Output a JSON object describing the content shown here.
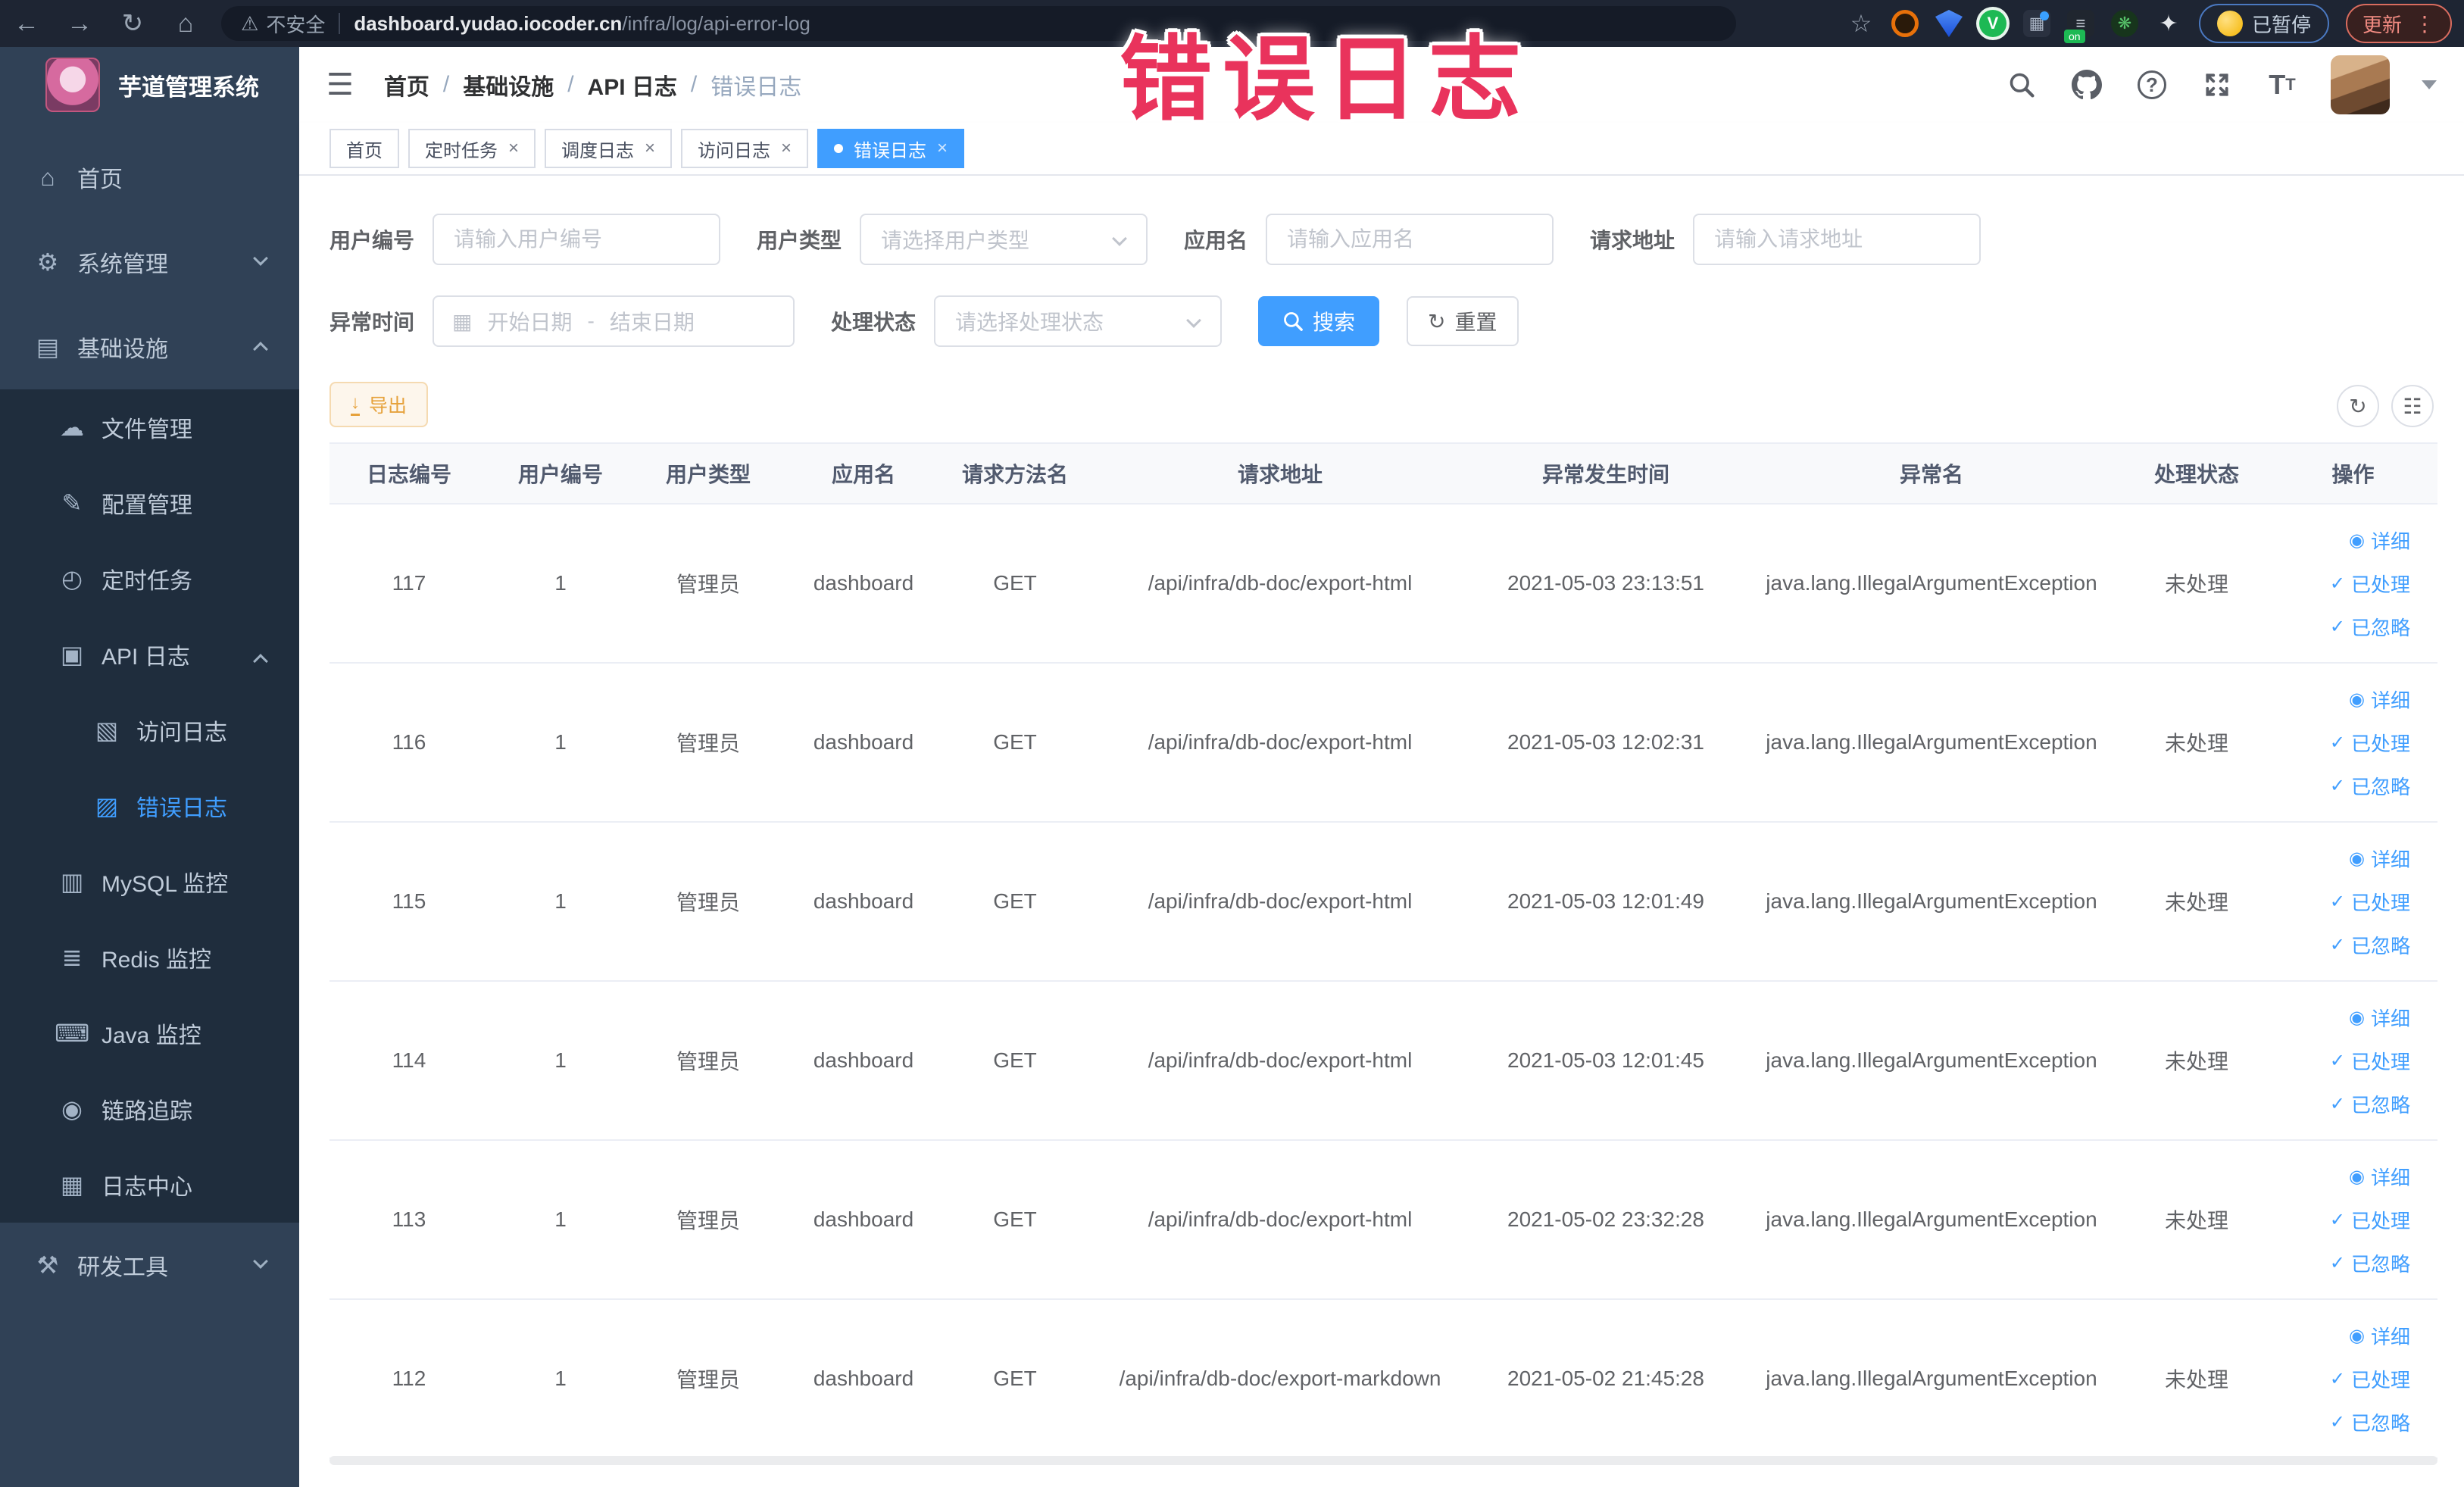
{
  "watermark": "错误日志",
  "browser": {
    "security_label": "不安全",
    "url_host": "dashboard.yudao.iocoder.cn",
    "url_path": "/infra/log/api-error-log",
    "paused_label": "已暂停",
    "update_label": "更新"
  },
  "sidebar": {
    "app_title": "芋道管理系统",
    "menu": [
      {
        "label": "首页",
        "icon": "home-icon",
        "glyph": "⌂"
      },
      {
        "label": "系统管理",
        "icon": "gear-icon",
        "glyph": "⚙",
        "chevron": "down"
      },
      {
        "label": "基础设施",
        "icon": "infrastructure-icon",
        "glyph": "▤",
        "chevron": "up",
        "children": [
          {
            "label": "文件管理",
            "icon": "file-upload-icon",
            "glyph": "☁"
          },
          {
            "label": "配置管理",
            "icon": "config-edit-icon",
            "glyph": "✎"
          },
          {
            "label": "定时任务",
            "icon": "scheduled-job-icon",
            "glyph": "◴"
          },
          {
            "label": "API 日志",
            "icon": "api-log-icon",
            "glyph": "▣",
            "chevron": "up",
            "children": [
              {
                "label": "访问日志",
                "icon": "access-log-icon",
                "glyph": "▧"
              },
              {
                "label": "错误日志",
                "icon": "error-log-icon",
                "glyph": "▨",
                "active": true
              }
            ]
          },
          {
            "label": "MySQL 监控",
            "icon": "mysql-monitor-icon",
            "glyph": "▥"
          },
          {
            "label": "Redis 监控",
            "icon": "redis-monitor-icon",
            "glyph": "≣"
          },
          {
            "label": "Java 监控",
            "icon": "java-monitor-icon",
            "glyph": "⌨"
          },
          {
            "label": "链路追踪",
            "icon": "trace-icon",
            "glyph": "◉"
          },
          {
            "label": "日志中心",
            "icon": "log-center-icon",
            "glyph": "▦"
          }
        ]
      },
      {
        "label": "研发工具",
        "icon": "dev-tool-icon",
        "glyph": "⚒",
        "chevron": "down"
      }
    ]
  },
  "navbar": {
    "breadcrumb": [
      "首页",
      "基础设施",
      "API 日志",
      "错误日志"
    ]
  },
  "tags": [
    {
      "label": "首页",
      "closable": false,
      "active": false
    },
    {
      "label": "定时任务",
      "closable": true,
      "active": false
    },
    {
      "label": "调度日志",
      "closable": true,
      "active": false
    },
    {
      "label": "访问日志",
      "closable": true,
      "active": false
    },
    {
      "label": "错误日志",
      "closable": true,
      "active": true
    }
  ],
  "filters": {
    "user_id_label": "用户编号",
    "user_id_placeholder": "请输入用户编号",
    "user_type_label": "用户类型",
    "user_type_placeholder": "请选择用户类型",
    "app_name_label": "应用名",
    "app_name_placeholder": "请输入应用名",
    "request_url_label": "请求地址",
    "request_url_placeholder": "请输入请求地址",
    "time_label": "异常时间",
    "time_start_placeholder": "开始日期",
    "time_separator": "-",
    "time_end_placeholder": "结束日期",
    "status_label": "处理状态",
    "status_placeholder": "请选择处理状态",
    "search_label": "搜索",
    "reset_label": "重置"
  },
  "toolbar": {
    "export_label": "导出"
  },
  "table": {
    "columns": [
      "日志编号",
      "用户编号",
      "用户类型",
      "应用名",
      "请求方法名",
      "请求地址",
      "异常发生时间",
      "异常名",
      "处理状态",
      "操作"
    ],
    "rows": [
      {
        "id": "117",
        "user_id": "1",
        "user_type": "管理员",
        "app_name": "dashboard",
        "method": "GET",
        "url": "/api/infra/db-doc/export-html",
        "time": "2021-05-03 23:13:51",
        "exception": "java.lang.IllegalArgumentException",
        "status": "未处理"
      },
      {
        "id": "116",
        "user_id": "1",
        "user_type": "管理员",
        "app_name": "dashboard",
        "method": "GET",
        "url": "/api/infra/db-doc/export-html",
        "time": "2021-05-03 12:02:31",
        "exception": "java.lang.IllegalArgumentException",
        "status": "未处理"
      },
      {
        "id": "115",
        "user_id": "1",
        "user_type": "管理员",
        "app_name": "dashboard",
        "method": "GET",
        "url": "/api/infra/db-doc/export-html",
        "time": "2021-05-03 12:01:49",
        "exception": "java.lang.IllegalArgumentException",
        "status": "未处理"
      },
      {
        "id": "114",
        "user_id": "1",
        "user_type": "管理员",
        "app_name": "dashboard",
        "method": "GET",
        "url": "/api/infra/db-doc/export-html",
        "time": "2021-05-03 12:01:45",
        "exception": "java.lang.IllegalArgumentException",
        "status": "未处理"
      },
      {
        "id": "113",
        "user_id": "1",
        "user_type": "管理员",
        "app_name": "dashboard",
        "method": "GET",
        "url": "/api/infra/db-doc/export-html",
        "time": "2021-05-02 23:32:28",
        "exception": "java.lang.IllegalArgumentException",
        "status": "未处理"
      },
      {
        "id": "112",
        "user_id": "1",
        "user_type": "管理员",
        "app_name": "dashboard",
        "method": "GET",
        "url": "/api/infra/db-doc/export-markdown",
        "time": "2021-05-02 21:45:28",
        "exception": "java.lang.IllegalArgumentException",
        "status": "未处理"
      }
    ],
    "row_actions": [
      {
        "label": "详细",
        "icon": "detail-eye-icon",
        "glyph": "◉"
      },
      {
        "label": "已处理",
        "icon": "processed-check-icon",
        "glyph": "✓"
      },
      {
        "label": "已忽略",
        "icon": "ignored-check-icon",
        "glyph": "✓"
      }
    ]
  },
  "colors": {
    "primary": "#409eff",
    "warning": "#e6a23c",
    "sidebar_bg": "#304156",
    "submenu_bg": "#1f2d3d",
    "watermark": "#e9335c"
  }
}
